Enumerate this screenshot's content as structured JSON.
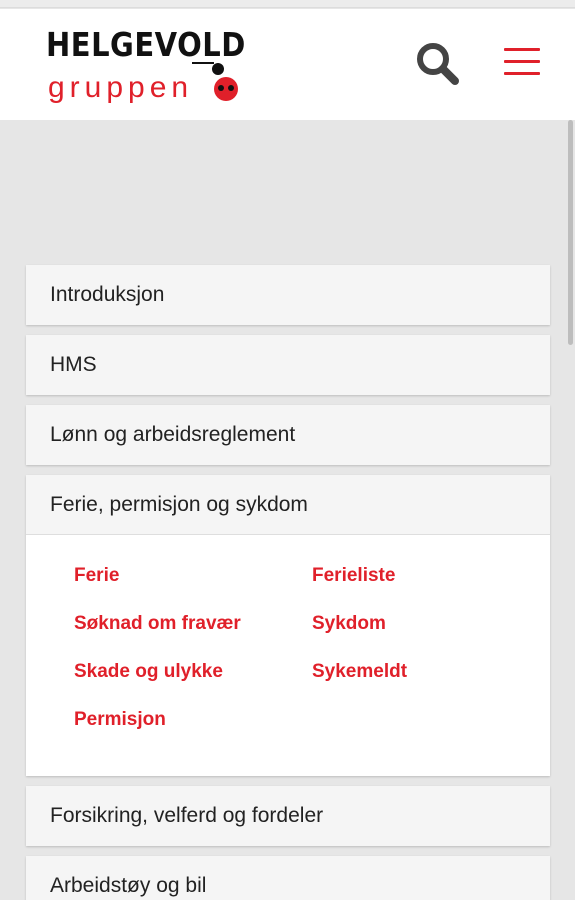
{
  "header": {
    "logo_top": "HELGEVOLD",
    "logo_bottom": "gruppen",
    "search_icon": "search-icon",
    "menu_icon": "hamburger-menu-icon"
  },
  "colors": {
    "brand_red": "#e0202a",
    "text": "#222222",
    "panel_bg": "#f5f5f5"
  },
  "accordion": {
    "sections": [
      {
        "label": "Introduksjon"
      },
      {
        "label": "HMS"
      },
      {
        "label": "Lønn og arbeidsreglement"
      },
      {
        "label": "Ferie, permisjon og sykdom",
        "expanded": true,
        "links": [
          "Ferie",
          "Ferieliste",
          "Søknad om fravær",
          "Sykdom",
          "Skade og ulykke",
          "Sykemeldt",
          "Permisjon"
        ]
      },
      {
        "label": "Forsikring, velferd og fordeler"
      },
      {
        "label": "Arbeidstøy og bil"
      }
    ]
  }
}
